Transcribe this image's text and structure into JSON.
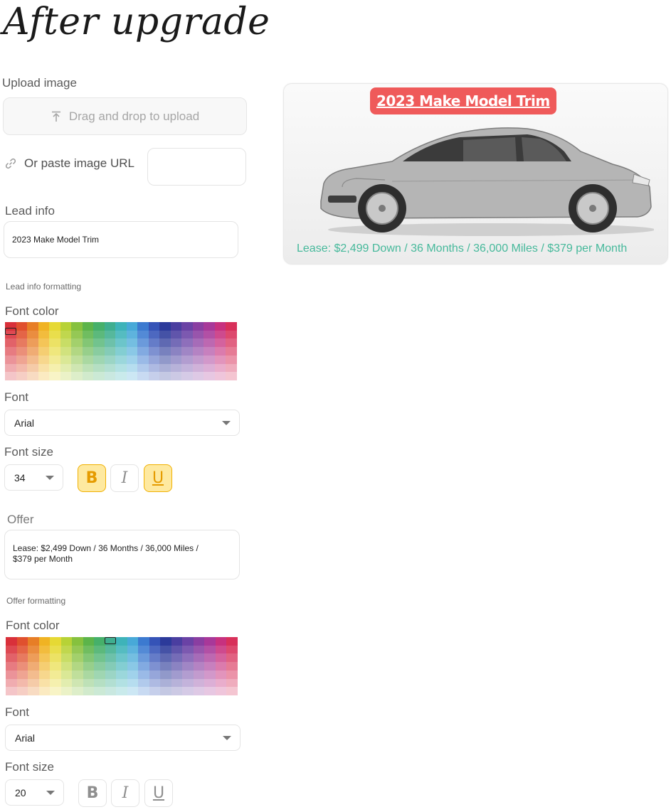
{
  "page_title": "After upgrade",
  "upload": {
    "label": "Upload image",
    "dropzone_text": "Drag and drop to upload",
    "paste_label": "Or paste image URL",
    "url_value": ""
  },
  "lead": {
    "label": "Lead info",
    "value": "2023 Make Model Trim",
    "formatting_label": "Lead info formatting",
    "font_color_label": "Font color",
    "selected_color": "#d63a3a",
    "font_label": "Font",
    "font_value": "Arial",
    "size_label": "Font size",
    "size_value": "34",
    "bold": true,
    "italic": false,
    "underline": true
  },
  "offer": {
    "label": "Offer",
    "value_line1": "Lease: $2,499 Down / 36 Months / 36,000 Miles /",
    "value_line2": "$379 per Month",
    "formatting_label": "Offer formatting",
    "font_color_label": "Font color",
    "selected_color": "#46b99b",
    "font_label": "Font",
    "font_value": "Arial",
    "size_label": "Font size",
    "size_value": "20",
    "bold": false,
    "italic": false,
    "underline": false
  },
  "preview": {
    "lead_text": "2023 Make Model Trim",
    "offer_text": "Lease: $2,499 Down / 36 Months / 36,000 Miles / $379 per Month",
    "badge_color": "#ef5a5a",
    "offer_color": "#46b99b"
  },
  "format_buttons": {
    "bold": "B",
    "italic": "I",
    "underline": "U"
  },
  "palette_columns": [
    "#d9303a",
    "#e0502e",
    "#e77e26",
    "#f0b323",
    "#e6d934",
    "#b7d236",
    "#86c13e",
    "#5cb44a",
    "#46b06a",
    "#3fae8f",
    "#3eb3b9",
    "#48a9d8",
    "#3c7ad0",
    "#3553b7",
    "#2c3a9a",
    "#4a3ea0",
    "#6a42a5",
    "#8a3ea1",
    "#a83899",
    "#c7317f",
    "#d8305a"
  ],
  "icons": [
    "upload-icon",
    "link-icon",
    "chevron-down-icon"
  ]
}
